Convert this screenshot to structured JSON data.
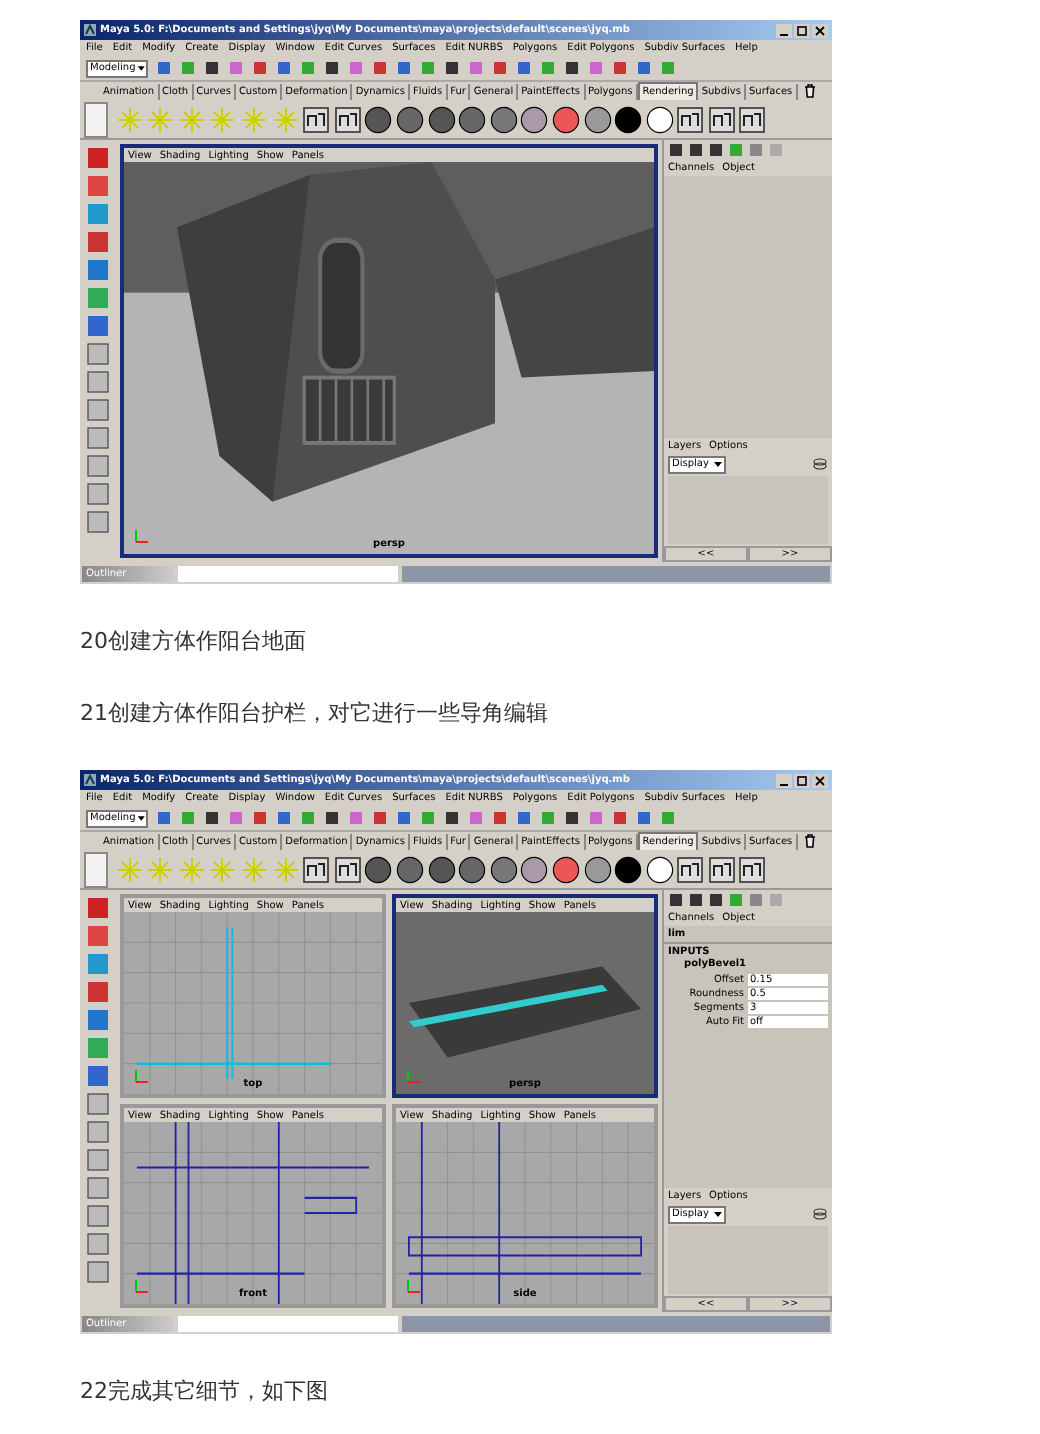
{
  "blocks": [
    {
      "kind": "maya",
      "title": "Maya 5.0: F:\\Documents and Settings\\jyq\\My Documents\\maya\\projects\\default\\scenes\\jyq.mb",
      "menus": [
        "File",
        "Edit",
        "Modify",
        "Create",
        "Display",
        "Window",
        "Edit Curves",
        "Surfaces",
        "Edit NURBS",
        "Polygons",
        "Edit Polygons",
        "Subdiv Surfaces",
        "Help"
      ],
      "mode": "Modeling",
      "shelf_tabs": [
        {
          "label": "Animation",
          "selected": false
        },
        {
          "label": "Cloth",
          "selected": false
        },
        {
          "label": "Curves",
          "selected": false
        },
        {
          "label": "Custom",
          "selected": false
        },
        {
          "label": "Deformation",
          "selected": false
        },
        {
          "label": "Dynamics",
          "selected": false
        },
        {
          "label": "Fluids",
          "selected": false
        },
        {
          "label": "Fur",
          "selected": false
        },
        {
          "label": "General",
          "selected": false
        },
        {
          "label": "PaintEffects",
          "selected": false
        },
        {
          "label": "Polygons",
          "selected": false
        },
        {
          "label": "Rendering",
          "selected": true
        },
        {
          "label": "Subdivs",
          "selected": false
        },
        {
          "label": "Surfaces",
          "selected": false
        }
      ],
      "viewports": [
        {
          "kind": "house",
          "menus": [
            "View",
            "Shading",
            "Lighting",
            "Show",
            "Panels"
          ],
          "label": "persp",
          "active": true
        }
      ],
      "channel_box": {
        "tabs": [
          "Channels",
          "Object"
        ]
      },
      "layers": {
        "tabs": [
          "Layers",
          "Options"
        ],
        "display": "Display",
        "prev": "<<",
        "next": ">>"
      },
      "outliner": "Outliner"
    },
    {
      "kind": "caption",
      "text": "20创建方体作阳台地面"
    },
    {
      "kind": "caption",
      "text": "21创建方体作阳台护栏，对它进行一些导角编辑"
    },
    {
      "kind": "maya",
      "title": "Maya 5.0: F:\\Documents and Settings\\jyq\\My Documents\\maya\\projects\\default\\scenes\\jyq.mb",
      "menus": [
        "File",
        "Edit",
        "Modify",
        "Create",
        "Display",
        "Window",
        "Edit Curves",
        "Surfaces",
        "Edit NURBS",
        "Polygons",
        "Edit Polygons",
        "Subdiv Surfaces",
        "Help"
      ],
      "mode": "Modeling",
      "shelf_tabs": [
        {
          "label": "Animation",
          "selected": false
        },
        {
          "label": "Cloth",
          "selected": false
        },
        {
          "label": "Curves",
          "selected": false
        },
        {
          "label": "Custom",
          "selected": false
        },
        {
          "label": "Deformation",
          "selected": false
        },
        {
          "label": "Dynamics",
          "selected": false
        },
        {
          "label": "Fluids",
          "selected": false
        },
        {
          "label": "Fur",
          "selected": false
        },
        {
          "label": "General",
          "selected": false
        },
        {
          "label": "PaintEffects",
          "selected": false
        },
        {
          "label": "Polygons",
          "selected": false
        },
        {
          "label": "Rendering",
          "selected": true
        },
        {
          "label": "Subdivs",
          "selected": false
        },
        {
          "label": "Surfaces",
          "selected": false
        }
      ],
      "viewports": [
        {
          "kind": "top",
          "menus": [
            "View",
            "Shading",
            "Lighting",
            "Show",
            "Panels"
          ],
          "label": "top",
          "active": false
        },
        {
          "kind": "beam",
          "menus": [
            "View",
            "Shading",
            "Lighting",
            "Show",
            "Panels"
          ],
          "label": "persp",
          "active": true
        },
        {
          "kind": "front",
          "menus": [
            "View",
            "Shading",
            "Lighting",
            "Show",
            "Panels"
          ],
          "label": "front",
          "active": false
        },
        {
          "kind": "side",
          "menus": [
            "View",
            "Shading",
            "Lighting",
            "Show",
            "Panels"
          ],
          "label": "side",
          "active": false
        }
      ],
      "channel_box": {
        "tabs": [
          "Channels",
          "Object"
        ],
        "object": "lim",
        "inputs_heading": "INPUTS",
        "node": "polyBevel1",
        "attributes": [
          {
            "name": "Offset",
            "value": "0.15"
          },
          {
            "name": "Roundness",
            "value": "0.5"
          },
          {
            "name": "Segments",
            "value": "3"
          },
          {
            "name": "Auto Fit",
            "value": "off"
          }
        ]
      },
      "layers": {
        "tabs": [
          "Layers",
          "Options"
        ],
        "display": "Display",
        "prev": "<<",
        "next": ">>"
      },
      "outliner": "Outliner"
    },
    {
      "kind": "caption",
      "text": "22完成其它细节，如下图"
    }
  ]
}
